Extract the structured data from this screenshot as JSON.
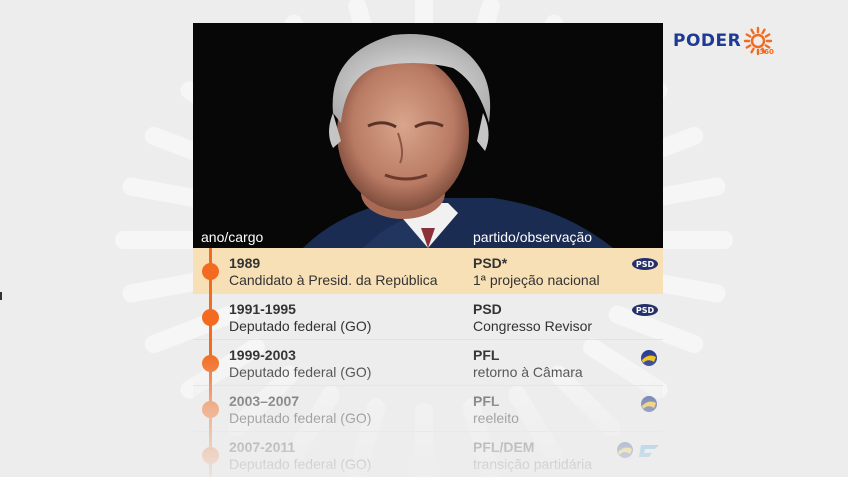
{
  "brand": {
    "name": "PODER",
    "sub": "360",
    "colors": {
      "blue": "#1f3a93",
      "orange": "#f26b21"
    }
  },
  "headers": {
    "left": "ano/cargo",
    "right": "partido/observação"
  },
  "rows": [
    {
      "year": "1989",
      "role": "Candidato à Presid. da República",
      "party": "PSD*",
      "note": "1ª projeção nacional",
      "badge": "psd-logo",
      "active": true
    },
    {
      "year": "1991-1995",
      "role": "Deputado federal (GO)",
      "party": "PSD",
      "note": "Congresso Revisor",
      "badge": "psd-logo",
      "active": false
    },
    {
      "year": "1999-2003",
      "role": "Deputado federal (GO)",
      "party": "PFL",
      "note": "retorno à Câmara",
      "badge": "pfl-logo",
      "active": false
    },
    {
      "year": "2003–2007",
      "role": "Deputado federal (GO)",
      "party": "PFL",
      "note": "reeleito",
      "badge": "pfl-logo",
      "active": false
    },
    {
      "year": "2007-2011",
      "role": "Deputado federal (GO)",
      "party": "PFL/DEM",
      "note": "transição partidária",
      "badge": "pfl-dem-logos",
      "active": false
    }
  ],
  "badges": {
    "psd": "PSD"
  }
}
